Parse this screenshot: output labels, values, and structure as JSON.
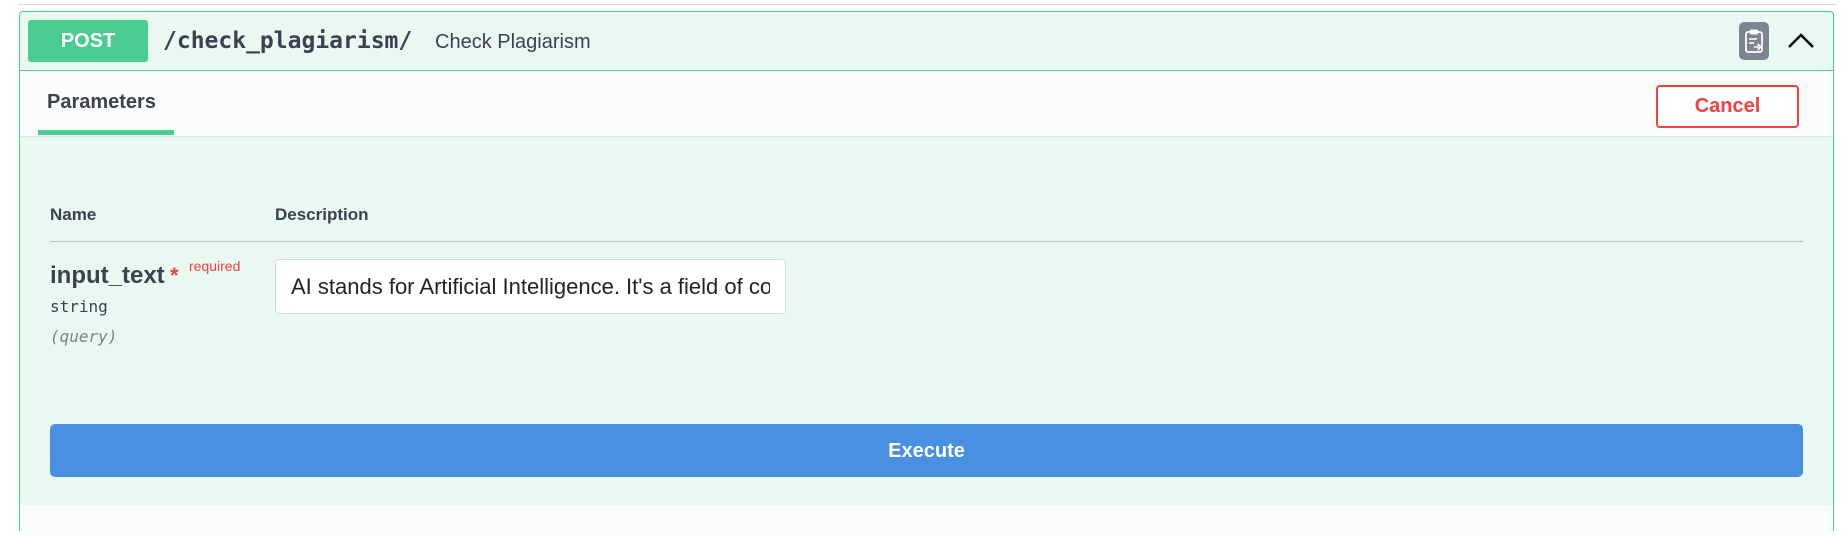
{
  "operation": {
    "method": "POST",
    "path": "/check_plagiarism/",
    "summary": "Check Plagiarism",
    "copy_icon": "clipboard-icon",
    "collapse_icon": "chevron-up-icon"
  },
  "tabs": {
    "parameters_label": "Parameters",
    "cancel_label": "Cancel"
  },
  "parameters": {
    "headers": {
      "name": "Name",
      "description": "Description"
    },
    "items": [
      {
        "name": "input_text",
        "required_star": "*",
        "required_label": "required",
        "type": "string",
        "in": "(query)",
        "value": "AI stands for Artificial Intelligence. It's a field of computer science"
      }
    ]
  },
  "actions": {
    "execute_label": "Execute"
  },
  "colors": {
    "post_green": "#49cc90",
    "block_bg": "#eaf8f2",
    "cancel_red": "#f93e3e",
    "execute_blue": "#4990e2"
  }
}
